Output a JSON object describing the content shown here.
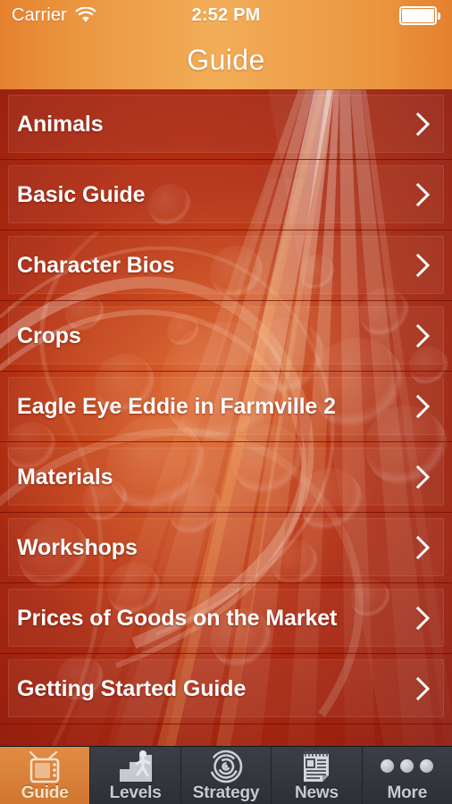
{
  "status_bar": {
    "carrier": "Carrier",
    "wifi_icon": "wifi-icon",
    "time": "2:52 PM",
    "battery_icon": "battery-icon"
  },
  "nav_bar": {
    "title": "Guide",
    "gradient_start": "#e4812f",
    "gradient_mid": "#f3ad58"
  },
  "theme": {
    "background_red": "#b02a10",
    "separator": "#6e0e04",
    "accent_orange": "#d9813a",
    "tabbar_dark": "#34383e"
  },
  "list": {
    "disclosure_icon": "chevron-right-icon",
    "items": [
      {
        "label": "Animals"
      },
      {
        "label": "Basic Guide"
      },
      {
        "label": "Character Bios"
      },
      {
        "label": "Crops"
      },
      {
        "label": "Eagle Eye Eddie in Farmville 2"
      },
      {
        "label": "Materials"
      },
      {
        "label": "Workshops"
      },
      {
        "label": "Prices of Goods on the Market"
      },
      {
        "label": "Getting Started Guide"
      }
    ]
  },
  "tab_bar": {
    "tabs": [
      {
        "label": "Guide",
        "icon": "television-icon",
        "active": true
      },
      {
        "label": "Levels",
        "icon": "stairs-person-icon",
        "active": false
      },
      {
        "label": "Strategy",
        "icon": "maze-icon",
        "active": false
      },
      {
        "label": "News",
        "icon": "notepad-icon",
        "active": false
      },
      {
        "label": "More",
        "icon": "ellipsis-icon",
        "active": false
      }
    ]
  }
}
